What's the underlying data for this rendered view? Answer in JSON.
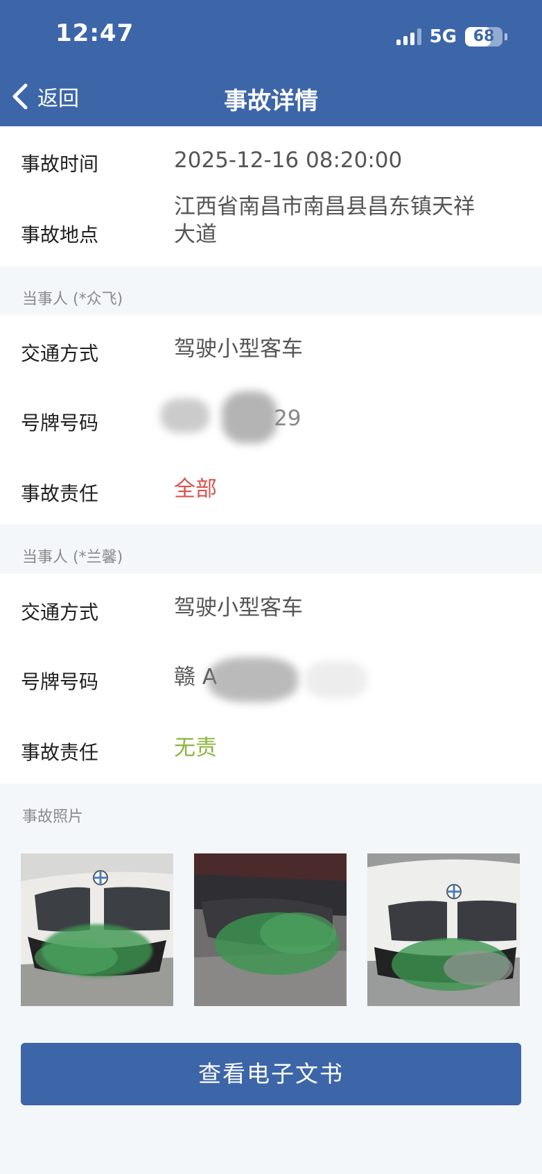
{
  "status_bar": {
    "time": "12:47",
    "network": "5G",
    "battery": "68",
    "battery_level": 0.68
  },
  "nav": {
    "back_label": "返回",
    "title": "事故详情"
  },
  "accident": {
    "time_label": "事故时间",
    "time_value": "2025-12-16 08:20:00",
    "location_label": "事故地点",
    "location_value": "江西省南昌市南昌县昌东镇天祥大道"
  },
  "party1": {
    "title": "当事人 (*众飞)",
    "transport_label": "交通方式",
    "transport_value": "驾驶小型客车",
    "plate_label": "号牌号码",
    "plate_value": "29",
    "responsibility_label": "事故责任",
    "responsibility_value": "全部"
  },
  "party2": {
    "title": "当事人 (*兰馨)",
    "transport_label": "交通方式",
    "transport_value": "驾驶小型客车",
    "plate_label": "号牌号码",
    "plate_value": "赣 A",
    "responsibility_label": "事故责任",
    "responsibility_value": "无责"
  },
  "photos": {
    "title": "事故照片"
  },
  "actions": {
    "view_document": "查看电子文书"
  },
  "colors": {
    "brand": "#3d66a9",
    "full_responsibility": "#d9534f",
    "no_responsibility": "#8cb33d"
  }
}
